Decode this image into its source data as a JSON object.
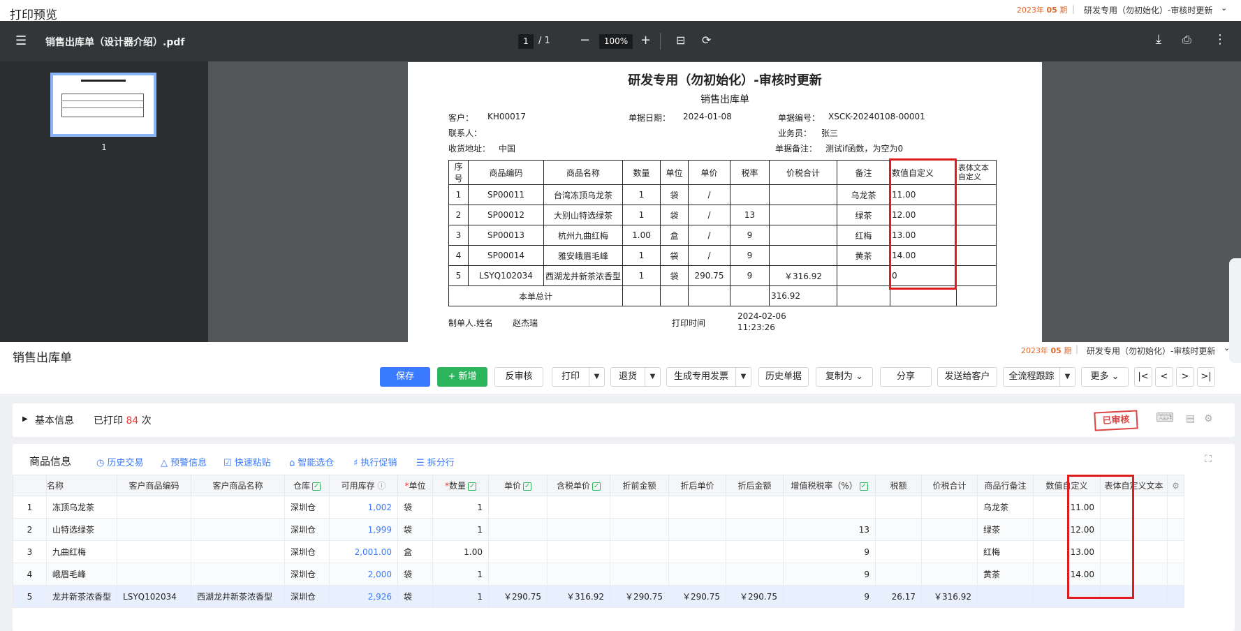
{
  "preview": {
    "title": "打印预览",
    "period_year": "2023年",
    "period_num": "05",
    "period_unit": "期",
    "org": "研发专用（勿初始化）-审核时更新"
  },
  "pdf_toolbar": {
    "filename": "销售出库单（设计器介绍）.pdf",
    "page": "1",
    "page_total": "/ 1",
    "zoom": "100%"
  },
  "sidebar": {
    "thumb_num": "1"
  },
  "pdf": {
    "title": "研发专用（勿初始化）-审核时更新",
    "subtitle": "销售出库单",
    "customer_label": "客户：",
    "customer": "KH00017",
    "date_label": "单据日期：",
    "date": "2024-01-08",
    "no_label": "单据编号：",
    "no": "XSCK-20240108-00001",
    "contact_label": "联系人：",
    "sales_label": "业务员：",
    "sales": "张三",
    "addr_label": "收货地址：",
    "addr": "中国",
    "note_label": "单据备注：",
    "note": "测试if函数，为空为0",
    "headers": [
      "序号",
      "商品编码",
      "商品名称",
      "数量",
      "单位",
      "单价",
      "税率",
      "价税合计",
      "备注",
      "数值自定义",
      "表体文本自定义"
    ],
    "rows": [
      [
        "1",
        "SP00011",
        "台湾冻顶乌龙茶",
        "1",
        "袋",
        "/",
        "",
        "",
        "乌龙茶",
        "11.00",
        ""
      ],
      [
        "2",
        "SP00012",
        "大别山特选绿茶",
        "1",
        "袋",
        "/",
        "13",
        "",
        "绿茶",
        "12.00",
        ""
      ],
      [
        "3",
        "SP00013",
        "杭州九曲红梅",
        "1.00",
        "盒",
        "/",
        "9",
        "",
        "红梅",
        "13.00",
        ""
      ],
      [
        "4",
        "SP00014",
        "雅安峨眉毛峰",
        "1",
        "袋",
        "/",
        "9",
        "",
        "黄茶",
        "14.00",
        ""
      ],
      [
        "5",
        "LSYQ102034",
        "西湖龙井新茶浓香型",
        "1",
        "袋",
        "290.75",
        "9",
        "￥316.92",
        "",
        "0",
        ""
      ]
    ],
    "total_label": "本单总计",
    "total": "316.92",
    "maker_label": "制单人.姓名",
    "maker": "赵杰瑞",
    "print_time_label": "打印时间",
    "print_time": "2024-02-06 11:23:26"
  },
  "app": {
    "title": "销售出库单",
    "period_year": "2023年",
    "period_num": "05",
    "period_unit": "期",
    "org": "研发专用（勿初始化）-审核时更新",
    "buttons": {
      "save": "保存",
      "add": "新增",
      "unaudit": "反审核",
      "print": "打印",
      "return": "退货",
      "invoice": "生成专用发票",
      "history": "历史单据",
      "copy": "复制为",
      "share": "分享",
      "send": "发送给客户",
      "trace": "全流程跟踪",
      "more": "更多"
    },
    "basic": {
      "label": "基本信息",
      "printed_prefix": "已打印",
      "printed_count": "84",
      "printed_suffix": "次",
      "stamp": "已审核"
    },
    "goods": {
      "label": "商品信息",
      "tools": [
        "历史交易",
        "预警信息",
        "快速粘贴",
        "智能选仓",
        "执行促销",
        "拆分行"
      ]
    },
    "grid_headers": [
      "",
      "名称",
      "客户商品编码",
      "客户商品名称",
      "仓库",
      "可用库存",
      "单位",
      "数量",
      "单价",
      "含税单价",
      "折前金额",
      "折后单价",
      "折后金额",
      "增值税税率（%）",
      "税额",
      "价税合计",
      "商品行备注",
      "数值自定义",
      "表体自定义文本",
      ""
    ],
    "grid_rows": [
      [
        "1",
        "冻顶乌龙茶",
        "",
        "",
        "深圳仓",
        "1,002",
        "袋",
        "1",
        "",
        "",
        "",
        "",
        "",
        "",
        "",
        "",
        "乌龙茶",
        "11.00",
        ""
      ],
      [
        "2",
        "山特选绿茶",
        "",
        "",
        "深圳仓",
        "1,999",
        "袋",
        "1",
        "",
        "",
        "",
        "",
        "",
        "13",
        "",
        "",
        "绿茶",
        "12.00",
        ""
      ],
      [
        "3",
        "九曲红梅",
        "",
        "",
        "深圳仓",
        "2,001.00",
        "盒",
        "1.00",
        "",
        "",
        "",
        "",
        "",
        "9",
        "",
        "",
        "红梅",
        "13.00",
        ""
      ],
      [
        "4",
        "峨眉毛峰",
        "",
        "",
        "深圳仓",
        "2,000",
        "袋",
        "1",
        "",
        "",
        "",
        "",
        "",
        "9",
        "",
        "",
        "黄茶",
        "14.00",
        ""
      ],
      [
        "5",
        "龙井新茶浓香型",
        "LSYQ102034",
        "西湖龙井新茶浓香型",
        "深圳仓",
        "2,926",
        "袋",
        "1",
        "￥290.75",
        "￥316.92",
        "￥290.75",
        "￥290.75",
        "￥290.75",
        "9",
        "26.17",
        "￥316.92",
        "",
        "",
        " "
      ]
    ]
  }
}
